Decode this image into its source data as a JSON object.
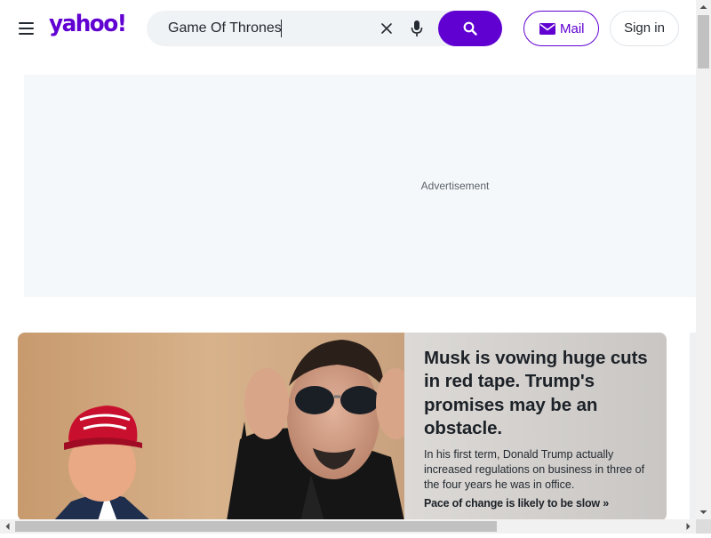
{
  "header": {
    "logo_text": "yahoo!",
    "menu_icon": "hamburger-menu-icon",
    "search": {
      "value": "Game Of Thrones",
      "clear_icon": "close-icon",
      "mic_icon": "microphone-icon",
      "submit_icon": "search-icon"
    },
    "mail_label": "Mail",
    "mail_icon": "envelope-icon",
    "signin_label": "Sign in"
  },
  "ad": {
    "label": "Advertisement"
  },
  "hero": {
    "headline": "Musk is vowing huge cuts in red tape. Trump's promises may be an obstacle.",
    "summary": "In his first term, Donald Trump actually increased regulations on business in three of the four years he was in office.",
    "more_link": "Pace of change is likely to be slow »",
    "hat_text": "MAKE AMERICA GREAT AGAIN"
  },
  "colors": {
    "brand_purple": "#6001d2",
    "ad_background": "#f5f8fa",
    "text_primary": "#1d2228"
  }
}
